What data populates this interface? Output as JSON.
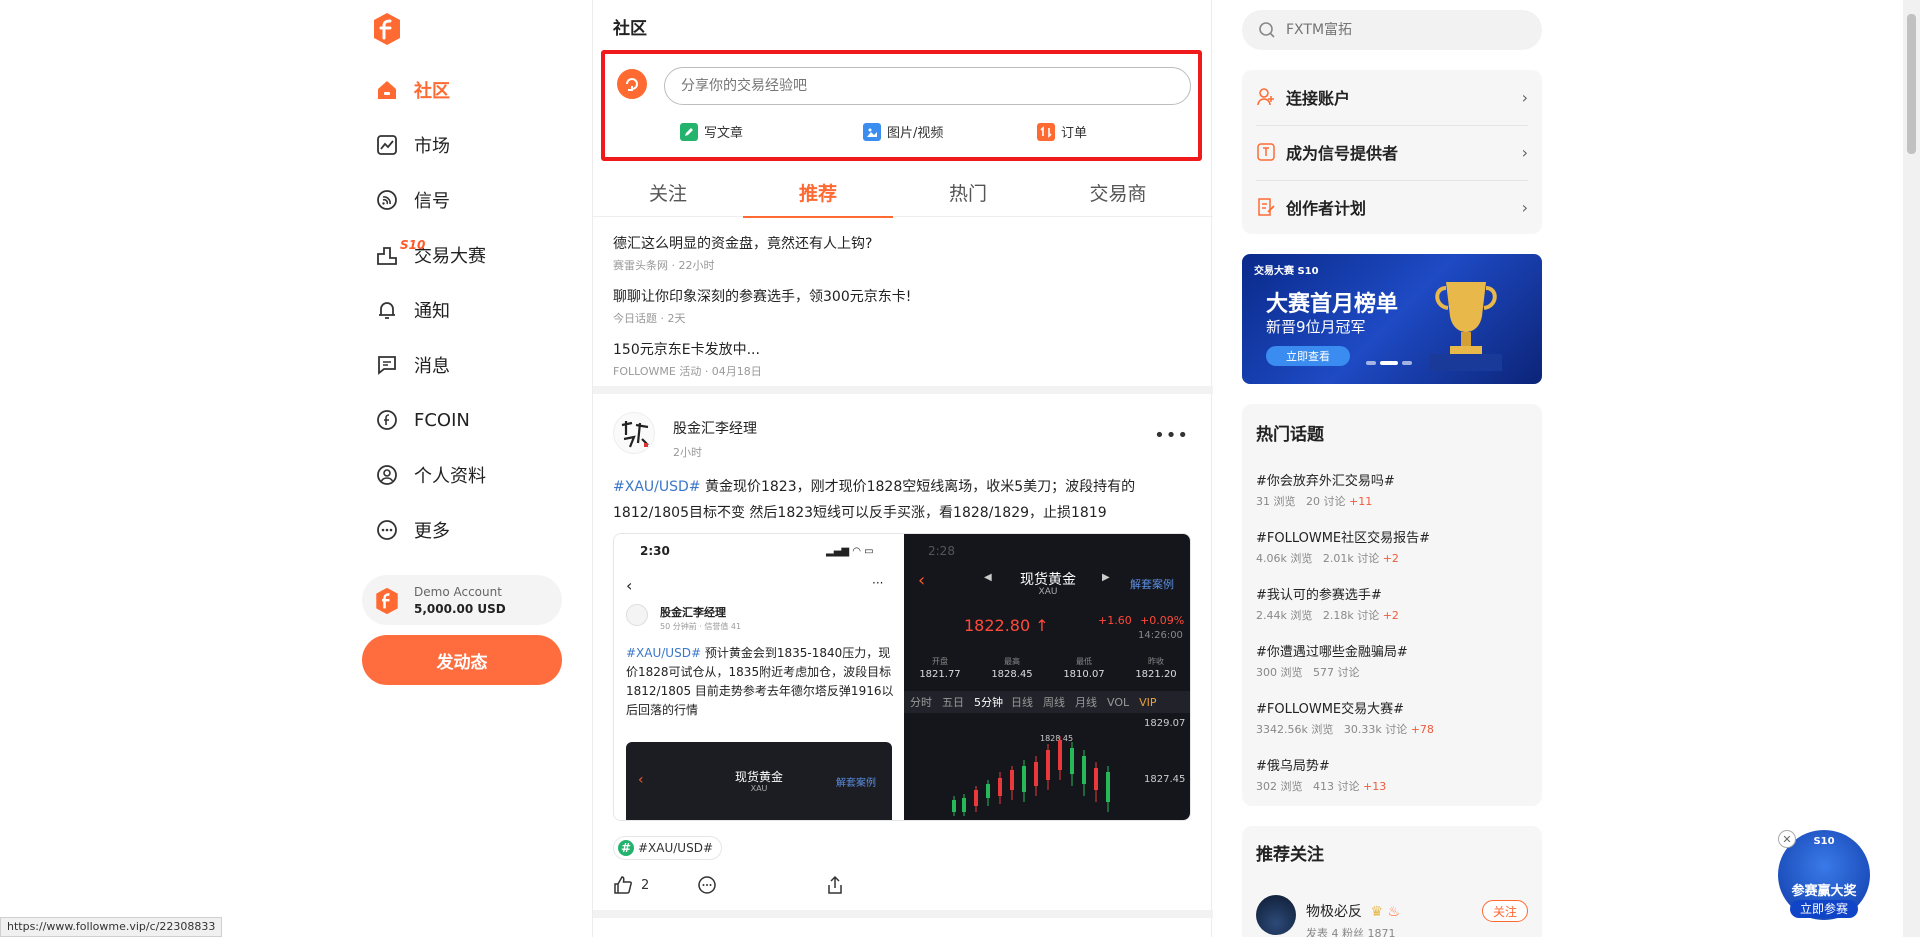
{
  "colors": {
    "accent": "#ff6a33",
    "highlight_border": "#f0191c",
    "link": "#3b77c8",
    "up": "#f05a3a"
  },
  "sidebar": {
    "items": [
      {
        "label": "社区",
        "icon": "home-icon",
        "active": true
      },
      {
        "label": "市场",
        "icon": "chart-icon"
      },
      {
        "label": "信号",
        "icon": "signal-icon"
      },
      {
        "label": "交易大赛",
        "icon": "contest-icon",
        "badge": "S10"
      },
      {
        "label": "通知",
        "icon": "bell-icon"
      },
      {
        "label": "消息",
        "icon": "message-icon"
      },
      {
        "label": "FCOIN",
        "icon": "fcoin-icon"
      },
      {
        "label": "个人资料",
        "icon": "user-icon"
      },
      {
        "label": "更多",
        "icon": "more-icon"
      }
    ],
    "demo_label": "Demo Account",
    "demo_value": "5,000.00 USD",
    "post_button": "发动态"
  },
  "main": {
    "title": "社区",
    "composer": {
      "placeholder": "分享你的交易经验吧",
      "actions": [
        "写文章",
        "图片/视频",
        "订单"
      ]
    },
    "tabs": [
      "关注",
      "推荐",
      "热门",
      "交易商"
    ],
    "active_tab": "推荐",
    "news": [
      {
        "title": "德汇这么明显的资金盘，竟然还有人上钩?",
        "meta": "赛雷头条网 · 22小时"
      },
      {
        "title": "聊聊让你印象深刻的参赛选手，领300元京东卡!",
        "meta": "今日话题 · 2天"
      },
      {
        "title": "150元京东E卡发放中...",
        "meta": "FOLLOWME 活动 · 04月18日"
      }
    ],
    "post": {
      "author": "股金汇李经理",
      "time": "2小时",
      "hashtag": "#XAU/USD#",
      "text": "黄金现价1823，刚才现价1828空短线离场，收米5美刀；波段持有的1812/1805目标不变 然后1823短线可以反手买涨，看1828/1829，止损1819",
      "screenshot_left": {
        "time": "2:30",
        "author": "股金汇李经理",
        "meta": "50 分钟前 · 信誉值 41",
        "hashtag": "#XAU/USD#",
        "text": "预计黄金会到1835-1840压力，现价1828可试仓从，1835附近考虑加仓，波段目标1812/1805 目前走势参考去年德尔塔反弹1916以后回落的行情",
        "inner_title": "现货黄金",
        "inner_sub": "XAU",
        "inner_link": "解套案例"
      },
      "screenshot_right": {
        "time": "2:28",
        "title": "现货黄金",
        "sub": "XAU",
        "link": "解套案例",
        "price": "1822.80",
        "change": "+1.60",
        "pct": "+0.09%",
        "clock": "14:26:00",
        "stats_labels": [
          "开盘",
          "最高",
          "最低",
          "昨收"
        ],
        "stats_values": [
          "1821.77",
          "1828.45",
          "1810.07",
          "1821.20"
        ],
        "periods": [
          "分时",
          "五日",
          "5分钟",
          "日线",
          "周线",
          "月线",
          "VOL",
          "VIP"
        ],
        "levels": [
          "1829.07",
          "1827.45"
        ],
        "high_mark": "1828.45"
      },
      "tag": "#XAU/USD#",
      "likes": "2"
    }
  },
  "right": {
    "search_placeholder": "FXTM富拓",
    "links": [
      "连接账户",
      "成为信号提供者",
      "创作者计划"
    ],
    "banner": {
      "small": "交易大赛 S10",
      "title": "大赛首月榜单",
      "sub": "新晋9位月冠军",
      "btn": "立即查看"
    },
    "topics_title": "热门话题",
    "topics": [
      {
        "title": "#你会放弃外汇交易吗#",
        "views": "31 浏览",
        "discuss": "20 讨论",
        "up": "+11"
      },
      {
        "title": "#FOLLOWME社区交易报告#",
        "views": "4.06k 浏览",
        "discuss": "2.01k 讨论",
        "up": "+2"
      },
      {
        "title": "#我认可的参赛选手#",
        "views": "2.44k 浏览",
        "discuss": "2.18k 讨论",
        "up": "+2"
      },
      {
        "title": "#你遭遇过哪些金融骗局#",
        "views": "300 浏览",
        "discuss": "577 讨论",
        "up": ""
      },
      {
        "title": "#FOLLOWME交易大赛#",
        "views": "3342.56k 浏览",
        "discuss": "30.33k 讨论",
        "up": "+78"
      },
      {
        "title": "#俄乌局势#",
        "views": "302 浏览",
        "discuss": "413 讨论",
        "up": "+13"
      }
    ],
    "recommend_title": "推荐关注",
    "recommend": {
      "name": "物极必反",
      "meta": "发表 4   粉丝 1871",
      "btn": "关注"
    }
  },
  "float_widget": {
    "top": "S10",
    "line1": "参赛赢大奖",
    "line2": "立即参赛",
    "close": "✕"
  },
  "status_url": "https://www.followme.vip/c/22308833"
}
